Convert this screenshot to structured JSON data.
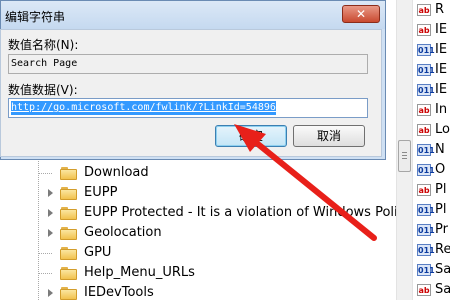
{
  "dialog": {
    "title": "编辑字符串",
    "close_glyph": "✕",
    "name_label": "数值名称(N):",
    "name_value": "Search Page",
    "data_label": "数值数据(V):",
    "data_value": "http://go.microsoft.com/fwlink/?LinkId=54896",
    "ok_label": "确定",
    "cancel_label": "取消"
  },
  "tree": {
    "items": [
      {
        "label": "Download",
        "expandable": false
      },
      {
        "label": "EUPP",
        "expandable": true
      },
      {
        "label": "EUPP Protected - It is a violation of Windows Policy to",
        "expandable": true
      },
      {
        "label": "Geolocation",
        "expandable": true
      },
      {
        "label": "GPU",
        "expandable": false
      },
      {
        "label": "Help_Menu_URLs",
        "expandable": false
      },
      {
        "label": "IEDevTools",
        "expandable": true
      }
    ]
  },
  "values_list": {
    "items": [
      {
        "type": "string",
        "icon": "ab",
        "text": "R"
      },
      {
        "type": "string",
        "icon": "ab",
        "text": "IE"
      },
      {
        "type": "binary",
        "icon": "011",
        "text": "IE"
      },
      {
        "type": "binary",
        "icon": "011",
        "text": "IE"
      },
      {
        "type": "binary",
        "icon": "011",
        "text": "IE"
      },
      {
        "type": "string",
        "icon": "ab",
        "text": "In"
      },
      {
        "type": "string",
        "icon": "ab",
        "text": "Lo"
      },
      {
        "type": "binary",
        "icon": "011",
        "text": "N"
      },
      {
        "type": "binary",
        "icon": "011",
        "text": "O"
      },
      {
        "type": "string",
        "icon": "ab",
        "text": "Pl"
      },
      {
        "type": "binary",
        "icon": "011",
        "text": "Pl"
      },
      {
        "type": "binary",
        "icon": "011",
        "text": "Pr"
      },
      {
        "type": "binary",
        "icon": "011",
        "text": "Re"
      },
      {
        "type": "binary",
        "icon": "011",
        "text": "Sa"
      },
      {
        "type": "string",
        "icon": "ab",
        "text": "Sa"
      }
    ]
  },
  "colors": {
    "selection": "#3399ff",
    "annotation_arrow": "#e8201a",
    "close_button": "#c94a30"
  }
}
